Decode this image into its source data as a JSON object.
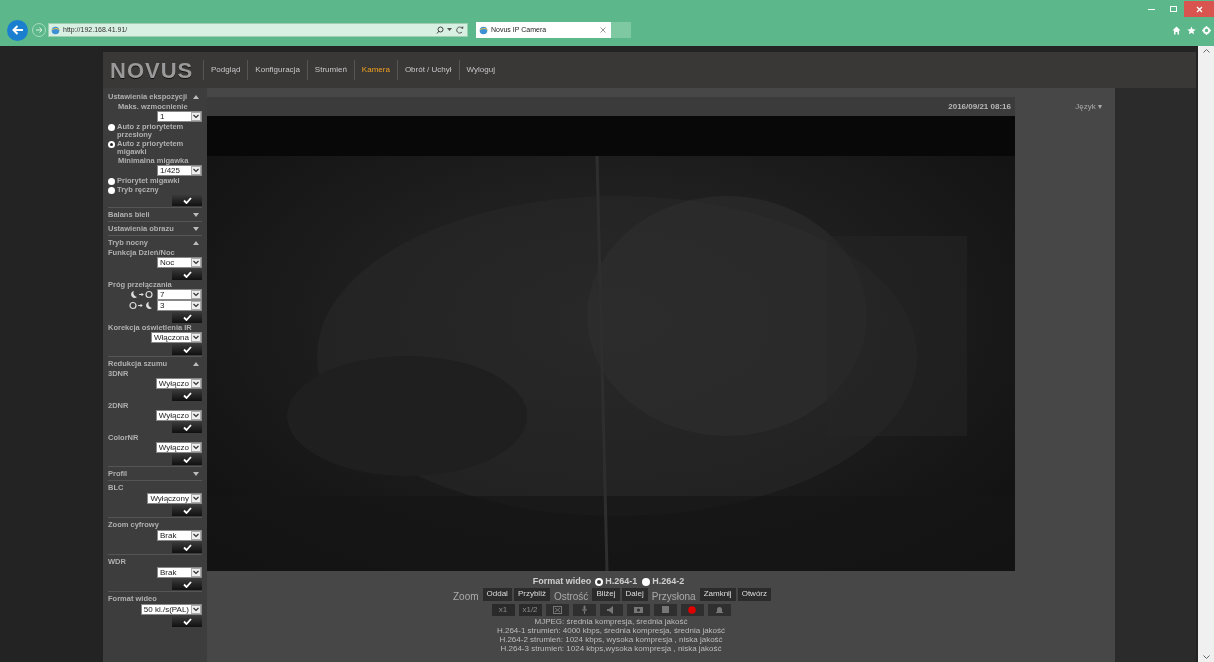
{
  "browser": {
    "url": "http://192.168.41.91/",
    "tab_title": "Novus IP Camera"
  },
  "nav": {
    "logo": "NOVUS",
    "items": [
      {
        "label": "Podgląd",
        "selected": false
      },
      {
        "label": "Konfiguracja",
        "selected": false
      },
      {
        "label": "Strumień",
        "selected": false
      },
      {
        "label": "Kamera",
        "selected": true
      },
      {
        "label": "Obrót / Uchył",
        "selected": false
      },
      {
        "label": "Wyloguj",
        "selected": false
      }
    ]
  },
  "sidebar": {
    "sections": [
      {
        "title": "Ustawienia ekspozycji",
        "expanded": true,
        "items": [
          {
            "kind": "sublabel",
            "text": "Maks. wzmocnienie"
          },
          {
            "kind": "select",
            "value": "1"
          },
          {
            "kind": "radio",
            "label": "Auto z priorytetem przesłony",
            "selected": false
          },
          {
            "kind": "radio",
            "label": "Auto z priorytetem migawki",
            "selected": true
          },
          {
            "kind": "sublabel",
            "text": "Minimalna migawka"
          },
          {
            "kind": "select",
            "value": "1/425"
          },
          {
            "kind": "radio",
            "label": "Priorytet migawki",
            "selected": false
          },
          {
            "kind": "radio",
            "label": "Tryb ręczny",
            "selected": false
          },
          {
            "kind": "apply"
          }
        ]
      },
      {
        "title": "Balans bieli",
        "expanded": false
      },
      {
        "title": "Ustawienia obrazu",
        "expanded": false
      },
      {
        "title": "Tryb nocny",
        "expanded": true,
        "items": [
          {
            "kind": "label",
            "text": "Funkcja Dzień/Noc"
          },
          {
            "kind": "select",
            "value": "Noc"
          },
          {
            "kind": "apply"
          },
          {
            "kind": "label",
            "text": "Próg przełączania"
          },
          {
            "kind": "threshold_to_day",
            "value": "7"
          },
          {
            "kind": "threshold_to_night",
            "value": "3"
          },
          {
            "kind": "apply"
          },
          {
            "kind": "label",
            "text": "Korekcja oświetlenia IR"
          },
          {
            "kind": "select",
            "value": "Włączona"
          },
          {
            "kind": "apply"
          }
        ]
      },
      {
        "title": "Redukcja szumu",
        "expanded": true,
        "items": [
          {
            "kind": "label",
            "text": "3DNR"
          },
          {
            "kind": "select",
            "value": "Wyłączo"
          },
          {
            "kind": "apply"
          },
          {
            "kind": "label",
            "text": "2DNR"
          },
          {
            "kind": "select",
            "value": "Wyłączo"
          },
          {
            "kind": "apply"
          },
          {
            "kind": "label",
            "text": "ColorNR"
          },
          {
            "kind": "select",
            "value": "Wyłączo"
          },
          {
            "kind": "apply"
          }
        ]
      },
      {
        "title": "Profil",
        "expanded": false
      },
      {
        "title": "BLC",
        "items": [
          {
            "kind": "select",
            "value": "Wyłączony"
          },
          {
            "kind": "apply"
          }
        ]
      },
      {
        "title": "Zoom cyfrowy",
        "items": [
          {
            "kind": "select",
            "value": "Brak"
          },
          {
            "kind": "apply"
          }
        ]
      },
      {
        "title": "WDR",
        "items": [
          {
            "kind": "select",
            "value": "Brak"
          },
          {
            "kind": "apply"
          }
        ]
      },
      {
        "title": "Format wideo",
        "items": [
          {
            "kind": "select",
            "value": "50 kl./s(PAL)"
          },
          {
            "kind": "apply"
          }
        ]
      }
    ]
  },
  "video": {
    "date": "2016/09/21 08:16",
    "language": "Język ▾"
  },
  "controls": {
    "format": {
      "label": "Format wideo",
      "options": [
        {
          "label": "H.264-1",
          "selected": true
        },
        {
          "label": "H.264-2",
          "selected": false
        }
      ]
    },
    "ptz": [
      {
        "kind": "label",
        "text": "Zoom"
      },
      {
        "kind": "button",
        "text": "Oddal"
      },
      {
        "kind": "button",
        "text": "Przybliż"
      },
      {
        "kind": "label",
        "text": "Ostrość"
      },
      {
        "kind": "button",
        "text": "Bliżej"
      },
      {
        "kind": "button",
        "text": "Dalej"
      },
      {
        "kind": "label",
        "text": "Przysłona"
      },
      {
        "kind": "button",
        "text": "Zamknij"
      },
      {
        "kind": "button",
        "text": "Otwórz"
      }
    ],
    "scale_buttons": [
      {
        "label": "x1",
        "disabled": true
      },
      {
        "label": "x1/2",
        "disabled": true
      }
    ],
    "info": [
      "MJPEG: średnia kompresja, średnia jakość",
      "H.264-1 strumień: 4000 kbps, średnia kompresja, średnia jakość",
      "H.264-2 strumień: 1024 kbps, wysoka kompresja , niska jakość",
      "H.264-3 strumień: 1024 kbps,wysoka kompresja , niska jakość"
    ]
  }
}
